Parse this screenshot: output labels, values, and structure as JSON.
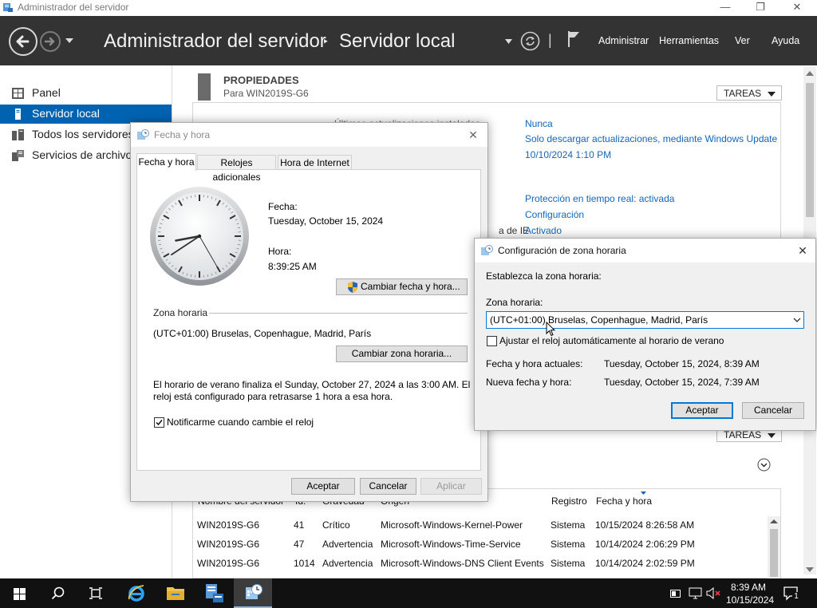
{
  "window": {
    "title": "Administrador del servidor"
  },
  "header": {
    "app_name": "Administrador del servidor",
    "crumb_sep": "‣",
    "current_page": "Servidor local",
    "menu": [
      "Administrar",
      "Herramientas",
      "Ver",
      "Ayuda"
    ],
    "separator": "|"
  },
  "sidebar": {
    "items": [
      {
        "label": "Panel",
        "icon": "dashboard-icon"
      },
      {
        "label": "Servidor local",
        "icon": "server-icon",
        "selected": true
      },
      {
        "label": "Todos los servidores",
        "icon": "servers-icon"
      },
      {
        "label": "Servicios de archivos",
        "icon": "file-services-icon"
      }
    ]
  },
  "properties": {
    "title": "PROPIEDADES",
    "subtitle": "Para WIN2019S-G6",
    "tasks_label": "TAREAS",
    "partial_label": "Últimas actualizaciones instaladas",
    "ie_label": "a de IE",
    "values": [
      "Nunca",
      "Solo descargar actualizaciones, mediante Windows Update",
      "10/10/2024 1:10 PM",
      "Protección en tiempo real: activada",
      "Configuración",
      "Activado"
    ]
  },
  "events": {
    "tasks_label": "TAREAS",
    "headers": [
      "Nombre del servidor",
      "Id.",
      "Gravedad",
      "Origen",
      "Registro",
      "Fecha y hora"
    ],
    "rows": [
      [
        "WIN2019S-G6",
        "41",
        "Crítico",
        "Microsoft-Windows-Kernel-Power",
        "Sistema",
        "10/15/2024 8:26:58 AM"
      ],
      [
        "WIN2019S-G6",
        "47",
        "Advertencia",
        "Microsoft-Windows-Time-Service",
        "Sistema",
        "10/14/2024 2:06:29 PM"
      ],
      [
        "WIN2019S-G6",
        "1014",
        "Advertencia",
        "Microsoft-Windows-DNS Client Events",
        "Sistema",
        "10/14/2024 2:02:59 PM"
      ]
    ]
  },
  "datetime_dialog": {
    "title": "Fecha y hora",
    "tabs": [
      "Fecha y hora",
      "Relojes adicionales",
      "Hora de Internet"
    ],
    "date_label": "Fecha:",
    "date_value": "Tuesday, October 15, 2024",
    "time_label": "Hora:",
    "time_value": "8:39:25 AM",
    "change_datetime_btn": "Cambiar fecha y hora...",
    "tz_section": "Zona horaria",
    "tz_value": "(UTC+01:00) Bruselas, Copenhague, Madrid, París",
    "change_tz_btn": "Cambiar zona horaria...",
    "dst_line1": "El horario de verano finaliza el Sunday, October 27, 2024 a las 3:00 AM. El",
    "dst_line2": "reloj está configurado para retrasarse 1 hora a esa hora.",
    "notify_label": "Notificarme cuando cambie el reloj",
    "notify_checked": true,
    "ok": "Aceptar",
    "cancel": "Cancelar",
    "apply": "Aplicar",
    "clock": {
      "hour": 8,
      "minute": 39,
      "second": 25
    }
  },
  "tz_dialog": {
    "title": "Configuración de zona horaria",
    "prompt": "Establezca la zona horaria:",
    "tz_label": "Zona horaria:",
    "tz_selected": "(UTC+01:00) Bruselas, Copenhague, Madrid, París",
    "dst_checkbox": "Ajustar el reloj automáticamente al horario de verano",
    "dst_checked": false,
    "current_label": "Fecha y hora actuales:",
    "current_value": "Tuesday, October 15, 2024, 8:39 AM",
    "new_label": "Nueva fecha y hora:",
    "new_value": "Tuesday, October 15, 2024, 7:39 AM",
    "ok": "Aceptar",
    "cancel": "Cancelar"
  },
  "taskbar": {
    "time": "8:39 AM",
    "date": "10/15/2024",
    "notifications": "1"
  },
  "colors": {
    "header_bg": "#333333",
    "selection": "#0063b1",
    "link": "#1565b8",
    "taskbar": "#111111"
  }
}
